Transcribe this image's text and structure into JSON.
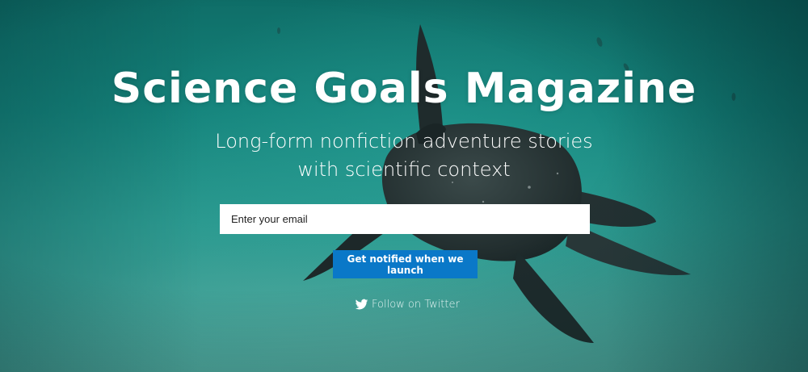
{
  "hero": {
    "title": "Science Goals Magazine",
    "tagline_line1": "Long-form nonfiction adventure stories",
    "tagline_line2": "with scientific context",
    "background_icon": "sea-turtle-photo"
  },
  "signup": {
    "email_placeholder": "Enter your email",
    "email_value": "",
    "button_label": "Get notified when we launch",
    "button_color": "#0a78c8"
  },
  "social": {
    "twitter_label": "Follow on Twitter",
    "twitter_icon": "twitter-bird-icon"
  }
}
